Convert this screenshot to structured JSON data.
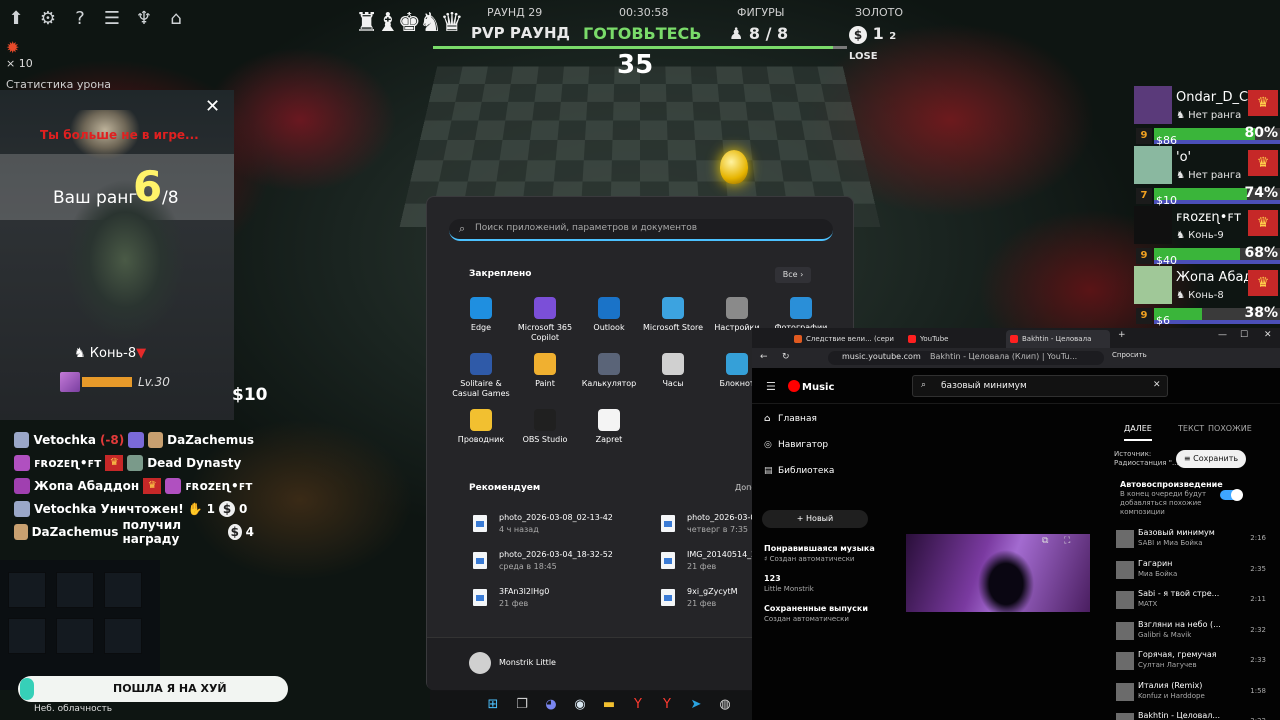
{
  "top_icons": [
    {
      "icon": "upload-icon",
      "glyph": "⬆"
    },
    {
      "icon": "gear-icon",
      "glyph": "⚙"
    },
    {
      "icon": "help-icon",
      "glyph": "?"
    },
    {
      "icon": "list-icon",
      "glyph": "☰"
    },
    {
      "icon": "trophy-icon",
      "glyph": "♆"
    },
    {
      "icon": "home-icon",
      "glyph": "⌂"
    }
  ],
  "item": {
    "count": "× 10"
  },
  "stats_title": "Статистика урона",
  "hud": {
    "pieces_glyph": "♜♝♚♞♛",
    "round_label": "РАУНД 29",
    "mode": "PVP РАУНД",
    "clock": "00:30:58",
    "phase": "ГОТОВЬТЕСЬ",
    "figures_label": "ФИГУРЫ",
    "figures_value": "8 / 8",
    "gold_label": "ЗОЛОТО",
    "gold_value": "1",
    "gold_streak": "2 LOSE",
    "timer": "35"
  },
  "rank_panel": {
    "close": "✕",
    "out_text": "Ты больше не в игре...",
    "rank_label": "Ваш ранг",
    "rank_num": "6",
    "rank_total": "/8",
    "rank_name": "Конь-8",
    "level": "Lv.30",
    "xp_fraction": 0.62
  },
  "coin_total": "10",
  "feed": [
    {
      "parts": [
        "Vetochka",
        "(-8)",
        "DaZachemus"
      ]
    },
    {
      "parts": [
        "ꜰʀᴏᴢᴇɳ•ꜰᴛ",
        "Dead Dynasty"
      ]
    },
    {
      "parts": [
        "Жопа Абаддон",
        "ꜰʀᴏᴢᴇɳ•ꜰᴛ"
      ]
    },
    {
      "parts": [
        "Vetochka",
        "Уничтожен!",
        "1",
        "0"
      ]
    },
    {
      "parts": [
        "DaZachemus",
        "получил награду",
        "4"
      ]
    }
  ],
  "notification": {
    "text": "ПОШЛА Я НА ХУЙ",
    "weather": "Неб. облачность"
  },
  "start_menu": {
    "search_placeholder": "Поиск приложений, параметров и документов",
    "pinned_label": "Закреплено",
    "all_label": "Все  ›",
    "apps": [
      {
        "label": "Edge",
        "color": "#1f8fe0"
      },
      {
        "label": "Microsoft 365 Copilot",
        "color": "#7b4fd8"
      },
      {
        "label": "Outlook",
        "color": "#1a73c8"
      },
      {
        "label": "Microsoft Store",
        "color": "#3ca3e0"
      },
      {
        "label": "Настройки",
        "color": "#8a8a8a"
      },
      {
        "label": "Фотографии",
        "color": "#2a8fd8"
      },
      {
        "label": "Solitaire & Casual Games",
        "color": "#2f5aa8"
      },
      {
        "label": "Paint",
        "color": "#f0b030"
      },
      {
        "label": "Калькулятор",
        "color": "#5a6478"
      },
      {
        "label": "Часы",
        "color": "#d0d0d0"
      },
      {
        "label": "Блокнот",
        "color": "#35a0d8"
      },
      {
        "label": "Проводник",
        "color": "#f2c030"
      },
      {
        "label": "OBS Studio",
        "color": "#202020"
      },
      {
        "label": "Zapret",
        "color": "#f4f4f4"
      }
    ],
    "recommended_label": "Рекомендуем",
    "more_label": "Допол",
    "recommended": [
      {
        "name": "photo_2026-03-08_02-13-42",
        "time": "4 ч назад"
      },
      {
        "name": "photo_2026-03-0",
        "time": "четверг в 7:35"
      },
      {
        "name": "photo_2026-03-04_18-32-52",
        "time": "среда в 18:45"
      },
      {
        "name": "IMG_20140514_2",
        "time": "21 фев"
      },
      {
        "name": "3FAn3l2lHg0",
        "time": "21 фев"
      },
      {
        "name": "9xi_gZycytM",
        "time": "21 фев"
      }
    ],
    "user": "Monstrik Little"
  },
  "players": [
    {
      "name": "Ondar_D_C",
      "rank": "Нет ранга",
      "level": "9",
      "gold": "$86",
      "pct": "80%",
      "hp": 0.8,
      "avatar": "#5a3a7a"
    },
    {
      "name": "'o'",
      "rank": "Нет ранга",
      "level": "7",
      "gold": "$10",
      "pct": "74%",
      "hp": 0.74,
      "avatar": "#8ab8a0"
    },
    {
      "name": "ꜰʀᴏᴢᴇɳ•ꜰᴛ",
      "rank": "Конь-9",
      "level": "9",
      "gold": "$40",
      "pct": "68%",
      "hp": 0.68,
      "avatar": "#101010"
    },
    {
      "name": "Жопа Абад",
      "rank": "Конь-8",
      "level": "9",
      "gold": "$6",
      "pct": "38%",
      "hp": 0.38,
      "avatar": "#a0c898"
    }
  ],
  "browser": {
    "tabs": [
      "Следствие вели... (сери",
      "YouTube",
      "Bakhtin - Целовала"
    ],
    "url_host": "music.youtube.com",
    "url_title": "Bakhtin - Целовала (Клип) | YouTu...",
    "ask": "Спросить",
    "logo": "Music",
    "search_query": "базовый минимум",
    "nav": [
      {
        "icon": "home-icon",
        "glyph": "⌂",
        "label": "Главная"
      },
      {
        "icon": "compass-icon",
        "glyph": "◎",
        "label": "Навигатор"
      },
      {
        "icon": "library-icon",
        "glyph": "▤",
        "label": "Библиотека"
      }
    ],
    "new_label": "+  Новый",
    "playlists": [
      {
        "title": "Понравившаяся музыка",
        "sub": "♯ Создан автоматически"
      },
      {
        "title": "123",
        "sub": "Little Monstrik"
      },
      {
        "title": "Сохраненные выпуски",
        "sub": "Создан автоматически"
      }
    ],
    "queue_tabs": [
      "ДАЛЕЕ",
      "ТЕКСТ",
      "ПОХОЖИЕ"
    ],
    "source": "Источник: Радиостанция \"...",
    "save": "Сохранить",
    "autoplay_title": "Автовоспроизведение",
    "autoplay_desc": "В конец очереди будут добавляться похожие композиции",
    "queue": [
      {
        "title": "Базовый минимум",
        "artist": "SABI и Миа Бойка",
        "dur": "2:16"
      },
      {
        "title": "Гагарин",
        "artist": "Миа Бойка",
        "dur": "2:35"
      },
      {
        "title": "Sabi - я твой стре...",
        "artist": "MATX",
        "dur": "2:11"
      },
      {
        "title": "Взгляни на небо (...",
        "artist": "Galibri & Mavik",
        "dur": "2:32"
      },
      {
        "title": "Горячая, гремучая",
        "artist": "Султан Лагучев",
        "dur": "2:33"
      },
      {
        "title": "Италия (Remix)",
        "artist": "Konfuz и Harddope",
        "dur": "1:58"
      },
      {
        "title": "Bakhtin - Целовал...",
        "artist": "",
        "dur": "3:22"
      }
    ]
  },
  "taskbar": [
    {
      "icon": "windows-icon",
      "glyph": "⊞",
      "color": "#4cc2ff"
    },
    {
      "icon": "taskview-icon",
      "glyph": "❐",
      "color": "#ccc"
    },
    {
      "icon": "discord-icon",
      "glyph": "◕",
      "color": "#7a86f0"
    },
    {
      "icon": "steam-icon",
      "glyph": "◉",
      "color": "#d8e6f0"
    },
    {
      "icon": "folder-icon",
      "glyph": "▬",
      "color": "#f2c030"
    },
    {
      "icon": "yandex-icon",
      "glyph": "Y",
      "color": "#ff3b30"
    },
    {
      "icon": "yandex-icon-2",
      "glyph": "Y",
      "color": "#ff3b30"
    },
    {
      "icon": "telegram-icon",
      "glyph": "➤",
      "color": "#2aa3e0"
    },
    {
      "icon": "obs-icon",
      "glyph": "◍",
      "color": "#dddddd"
    }
  ]
}
